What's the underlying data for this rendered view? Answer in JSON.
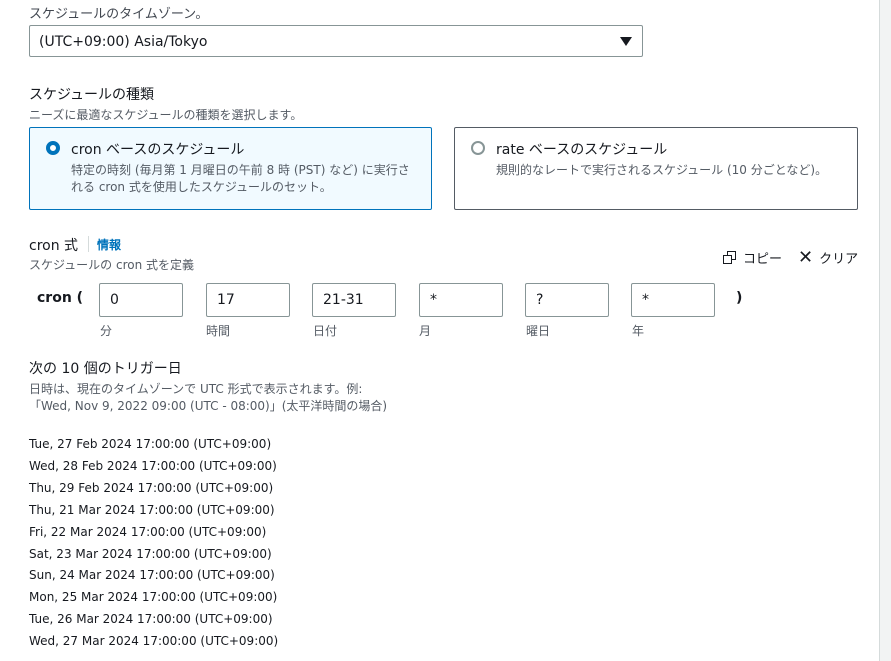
{
  "timezone": {
    "label": "スケジュールのタイムゾーン。",
    "value": "(UTC+09:00) Asia/Tokyo"
  },
  "schedule_type": {
    "title": "スケジュールの種類",
    "description": "ニーズに最適なスケジュールの種類を選択します。",
    "options": [
      {
        "title": "cron ベースのスケジュール",
        "description": "特定の時刻 (毎月第 1 月曜日の午前 8 時 (PST) など) に実行される cron 式を使用したスケジュールのセット。",
        "selected": true
      },
      {
        "title": "rate ベースのスケジュール",
        "description": "規則的なレートで実行されるスケジュール (10 分ごとなど)。",
        "selected": false
      }
    ]
  },
  "cron": {
    "title": "cron 式",
    "info_link": "情報",
    "description": "スケジュールの cron 式を定義",
    "copy_label": "コピー",
    "clear_label": "クリア",
    "prefix": "cron (",
    "suffix": ")",
    "fields": [
      {
        "value": "0",
        "label": "分"
      },
      {
        "value": "17",
        "label": "時間"
      },
      {
        "value": "21-31",
        "label": "日付"
      },
      {
        "value": "*",
        "label": "月"
      },
      {
        "value": "?",
        "label": "曜日"
      },
      {
        "value": "*",
        "label": "年"
      }
    ]
  },
  "next_triggers": {
    "title": "次の 10 個のトリガー日",
    "description_line1": "日時は、現在のタイムゾーンで UTC 形式で表示されます。例:",
    "description_line2": "「Wed, Nov 9, 2022 09:00 (UTC - 08:00)」(太平洋時間の場合)",
    "dates": [
      "Tue, 27 Feb 2024 17:00:00 (UTC+09:00)",
      "Wed, 28 Feb 2024 17:00:00 (UTC+09:00)",
      "Thu, 29 Feb 2024 17:00:00 (UTC+09:00)",
      "Thu, 21 Mar 2024 17:00:00 (UTC+09:00)",
      "Fri, 22 Mar 2024 17:00:00 (UTC+09:00)",
      "Sat, 23 Mar 2024 17:00:00 (UTC+09:00)",
      "Sun, 24 Mar 2024 17:00:00 (UTC+09:00)",
      "Mon, 25 Mar 2024 17:00:00 (UTC+09:00)",
      "Tue, 26 Mar 2024 17:00:00 (UTC+09:00)",
      "Wed, 27 Mar 2024 17:00:00 (UTC+09:00)"
    ]
  },
  "colors": {
    "accent": "#0073bb",
    "selected_tile_bg": "#f1faff",
    "text": "#16191f",
    "muted_text": "#545b64"
  },
  "icons": {
    "select_caret": "caret-down-icon",
    "copy": "copy-icon",
    "clear": "close-icon"
  }
}
